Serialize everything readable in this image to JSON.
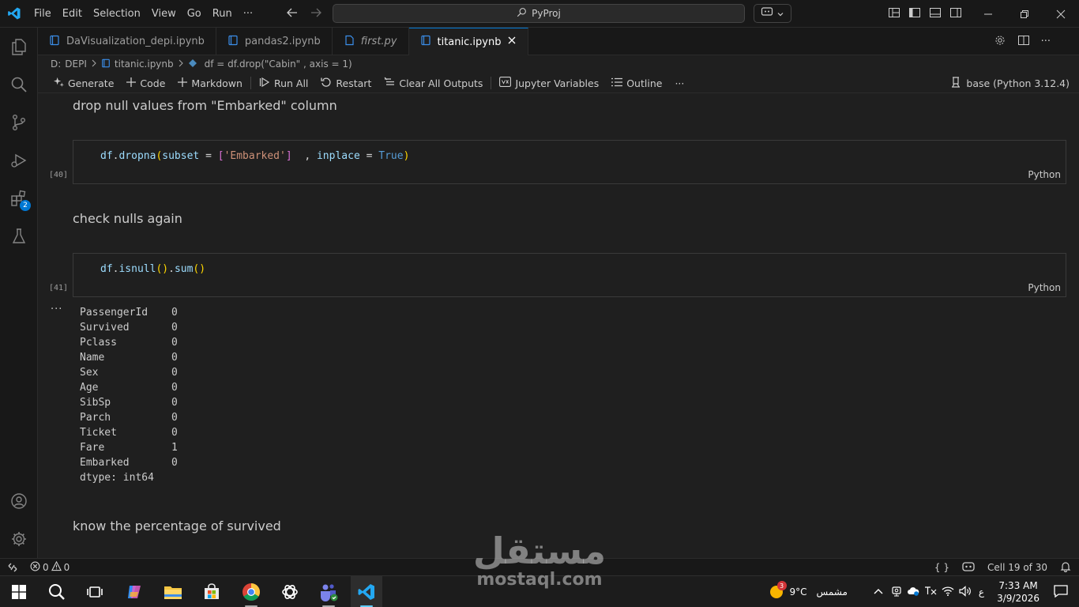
{
  "titlebar": {
    "menu": [
      "File",
      "Edit",
      "Selection",
      "View",
      "Go",
      "Run",
      "···"
    ],
    "search_text": "PyProj"
  },
  "tabs": [
    {
      "label": "DaVisualization_depi.ipynb",
      "active": false,
      "italic": false
    },
    {
      "label": "pandas2.ipynb",
      "active": false,
      "italic": false
    },
    {
      "label": "first.py",
      "active": false,
      "italic": true
    },
    {
      "label": "titanic.ipynb",
      "active": true,
      "italic": false
    }
  ],
  "breadcrumb": {
    "drive": "D:",
    "folder": "DEPI",
    "file": "titanic.ipynb",
    "cell": "df = df.drop(\"Cabin\" , axis = 1)"
  },
  "toolbar": {
    "generate": "Generate",
    "code": "Code",
    "markdown": "Markdown",
    "run_all": "Run All",
    "restart": "Restart",
    "clear_outputs": "Clear All Outputs",
    "variables": "Jupyter Variables",
    "outline": "Outline",
    "more": "···",
    "kernel": "base (Python 3.12.4)"
  },
  "notebook": {
    "md1": "drop null values from \"Embarked\" column",
    "cell1": {
      "exec": "[40]",
      "lang": "Python",
      "tokens": [
        "df",
        ".",
        "dropna",
        "(",
        "subset",
        " = ",
        "[",
        "'Embarked'",
        "]",
        "  , ",
        "inplace",
        " = ",
        "True",
        ")"
      ]
    },
    "md2": "check nulls again",
    "cell2": {
      "exec": "[41]",
      "lang": "Python",
      "tokens": [
        "df",
        ".",
        "isnull",
        "()",
        ".",
        "sum",
        "()"
      ]
    },
    "output_dots": "···",
    "output_rows": [
      {
        "col": "PassengerId",
        "val": "0"
      },
      {
        "col": "Survived",
        "val": "0"
      },
      {
        "col": "Pclass",
        "val": "0"
      },
      {
        "col": "Name",
        "val": "0"
      },
      {
        "col": "Sex",
        "val": "0"
      },
      {
        "col": "Age",
        "val": "0"
      },
      {
        "col": "SibSp",
        "val": "0"
      },
      {
        "col": "Parch",
        "val": "0"
      },
      {
        "col": "Ticket",
        "val": "0"
      },
      {
        "col": "Fare",
        "val": "1"
      },
      {
        "col": "Embarked",
        "val": "0"
      }
    ],
    "dtype": "dtype: int64",
    "md3": "know the percentage of survived"
  },
  "activitybar": {
    "extensions_badge": "2"
  },
  "statusbar": {
    "errors": "0",
    "warnings": "0",
    "braces": "{ }",
    "cell_position": "Cell 19 of 30"
  },
  "taskbar": {
    "weather_temp": "9°C",
    "weather_label": "مشمس",
    "weather_badge": "3",
    "lang": "ع",
    "time": "7:33 AM",
    "date": "3/9/2026"
  },
  "watermark": {
    "arabic": "مستقل",
    "latin": "mostaql.com"
  },
  "colors": {
    "accent": "#0078d4",
    "editor_bg": "#1f1f1f",
    "chrome_bg": "#181818"
  }
}
